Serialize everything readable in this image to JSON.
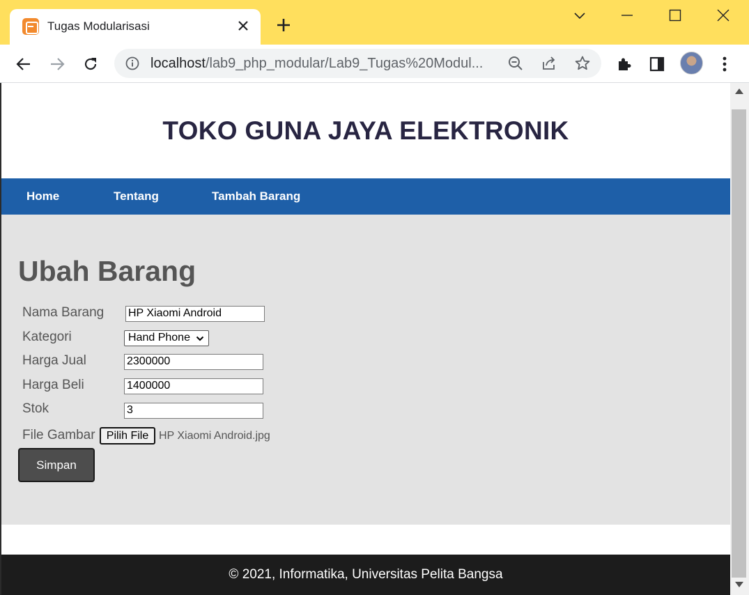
{
  "browser": {
    "tab_title": "Tugas Modularisasi",
    "tab_favicon": "xampp-icon",
    "url_host": "localhost",
    "url_path": "/lab9_php_modular/Lab9_Tugas%20Modul...",
    "theme_color": "#ffdf5d"
  },
  "site": {
    "title": "TOKO GUNA JAYA ELEKTRONIK",
    "nav": [
      "Home",
      "Tentang",
      "Tambah Barang"
    ],
    "nav_color": "#1e5fa8"
  },
  "form": {
    "heading": "Ubah Barang",
    "fields": {
      "nama_label": "Nama Barang",
      "nama_value": "HP Xiaomi Android",
      "kategori_label": "Kategori",
      "kategori_value": "Hand Phone",
      "harga_jual_label": "Harga Jual",
      "harga_jual_value": "2300000",
      "harga_beli_label": "Harga Beli",
      "harga_beli_value": "1400000",
      "stok_label": "Stok",
      "stok_value": "3",
      "gambar_label": "File Gambar",
      "file_button": "Pilih File",
      "file_name": "HP Xiaomi Android.jpg"
    },
    "submit_label": "Simpan"
  },
  "footer": {
    "text": "© 2021, Informatika, Universitas Pelita Bangsa"
  }
}
